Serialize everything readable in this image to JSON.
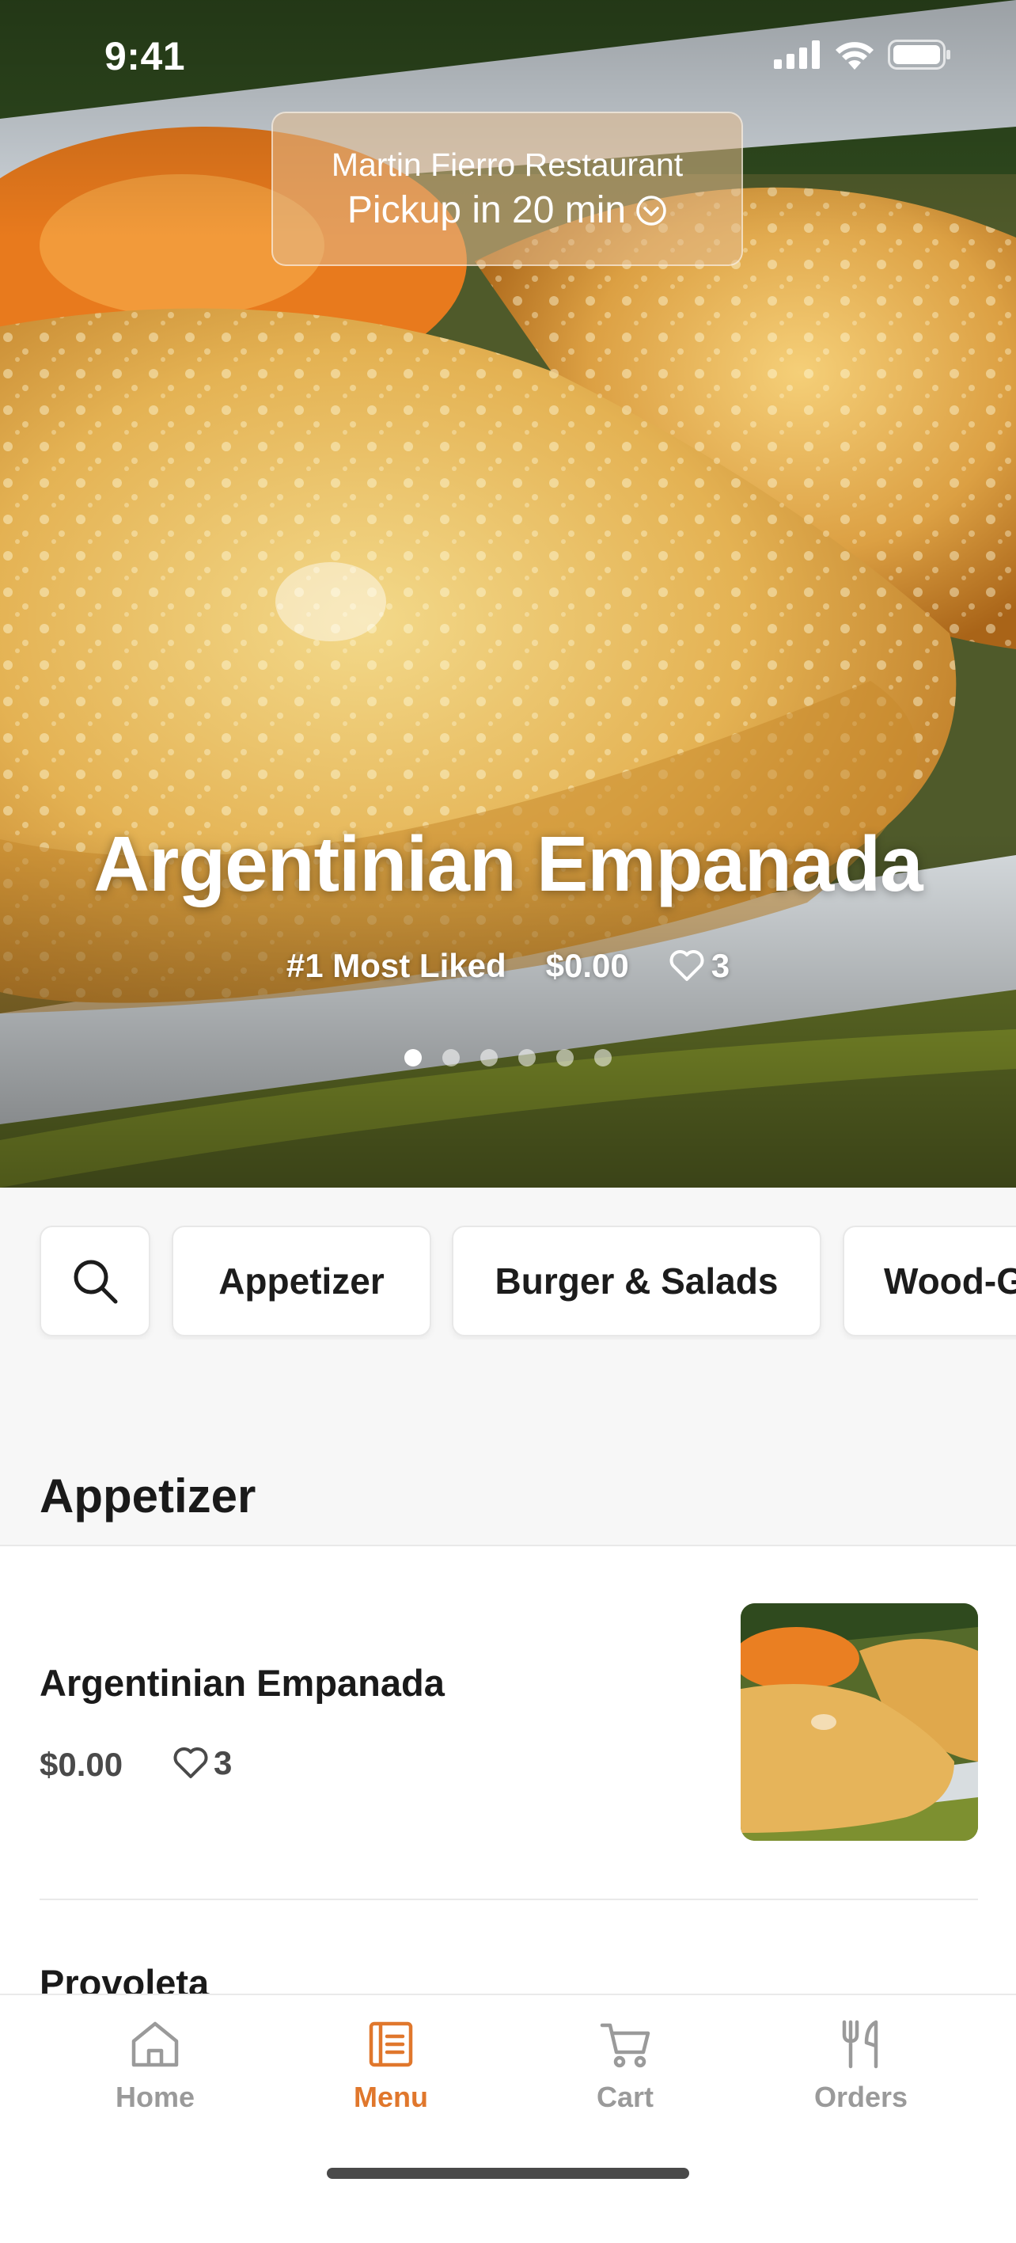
{
  "status_bar": {
    "time": "9:41"
  },
  "pickup": {
    "restaurant": "Martin Fierro Restaurant",
    "time_label": "Pickup in 20 min"
  },
  "hero": {
    "title": "Argentinian Empanada",
    "rank": "#1 Most Liked",
    "price": "$0.00",
    "likes": "3",
    "slides_total": 6,
    "slide_active": 1
  },
  "categories": {
    "chips": [
      "Appetizer",
      "Burger & Salads",
      "Wood-Grilled"
    ]
  },
  "menu": {
    "section_title": "Appetizer",
    "items": [
      {
        "name": "Argentinian Empanada",
        "price": "$0.00",
        "likes": "3"
      },
      {
        "name": "Provoleta"
      }
    ]
  },
  "tabbar": {
    "tabs": [
      {
        "label": "Home",
        "icon": "home-icon"
      },
      {
        "label": "Menu",
        "icon": "menu-book-icon"
      },
      {
        "label": "Cart",
        "icon": "cart-icon"
      },
      {
        "label": "Orders",
        "icon": "utensils-icon"
      }
    ],
    "active": "Menu"
  },
  "colors": {
    "accent": "#e0772c",
    "tab_inactive": "#9a9a9a",
    "background": "#f7f7f7"
  }
}
